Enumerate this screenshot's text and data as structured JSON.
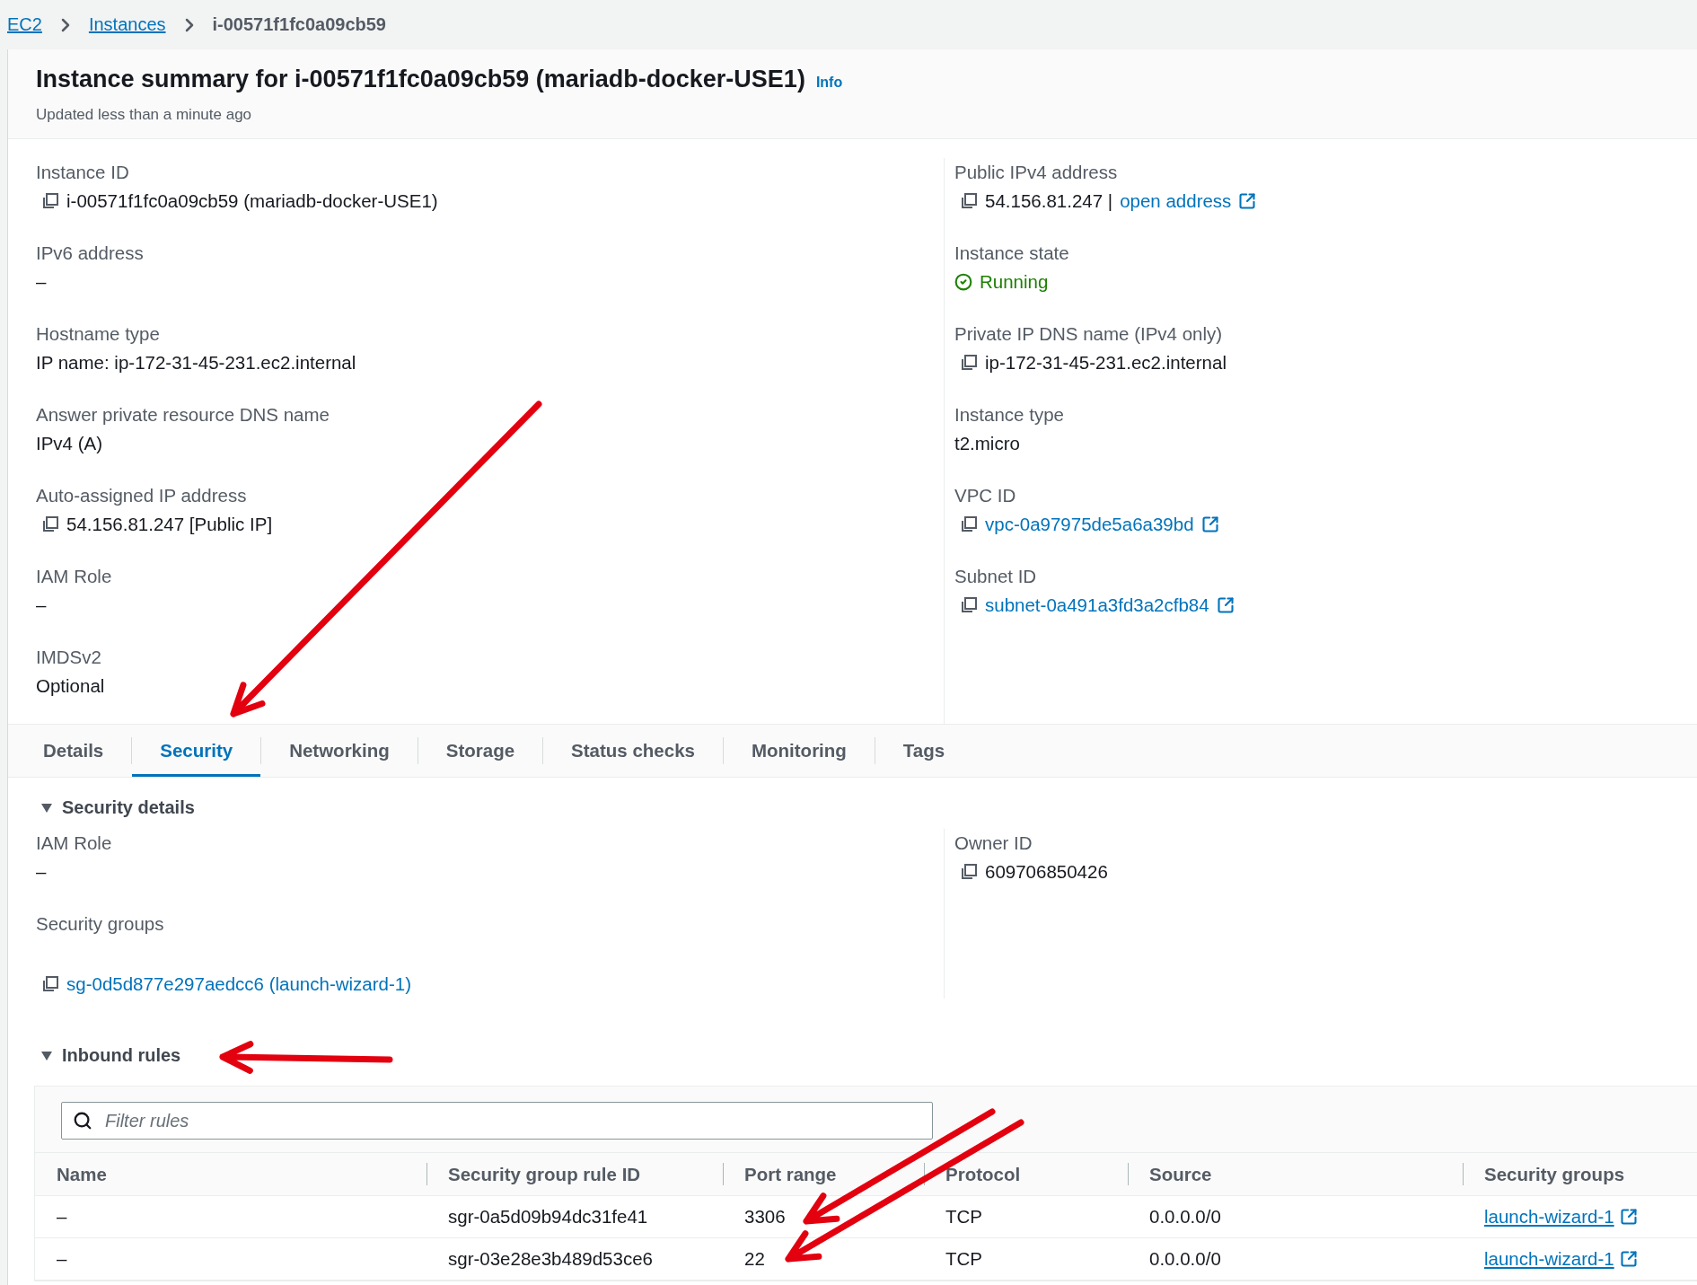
{
  "breadcrumb": [
    {
      "label": "EC2",
      "kind": "link"
    },
    {
      "label": "Instances",
      "kind": "link"
    },
    {
      "label": "i-00571f1fc0a09cb59",
      "kind": "current"
    }
  ],
  "summary": {
    "title": "Instance summary for i-00571f1fc0a09cb59 (mariadb-docker-USE1)",
    "info": "Info",
    "updated": "Updated less than a minute ago"
  },
  "fields_left": [
    {
      "label": "Instance ID",
      "value": "i-00571f1fc0a09cb59 (mariadb-docker-USE1)",
      "kind": "copy"
    },
    {
      "label": "IPv6 address",
      "value": "–",
      "kind": "text"
    },
    {
      "label": "Hostname type",
      "value": "IP name: ip-172-31-45-231.ec2.internal",
      "kind": "text"
    },
    {
      "label": "Answer private resource DNS name",
      "value": "IPv4 (A)",
      "kind": "text"
    },
    {
      "label": "Auto-assigned IP address",
      "value": "54.156.81.247 [Public IP]",
      "kind": "copy"
    },
    {
      "label": "IAM Role",
      "value": "–",
      "kind": "text"
    },
    {
      "label": "IMDSv2",
      "value": "Optional",
      "kind": "text"
    }
  ],
  "fields_right": [
    {
      "label": "Public IPv4 address",
      "value": "54.156.81.247 |",
      "link": "open address",
      "external": true,
      "kind": "copy"
    },
    {
      "label": "Instance state",
      "value": "Running",
      "kind": "status"
    },
    {
      "label": "Private IP DNS name (IPv4 only)",
      "value": "ip-172-31-45-231.ec2.internal",
      "kind": "copy"
    },
    {
      "label": "Instance type",
      "value": "t2.micro",
      "kind": "text"
    },
    {
      "label": "VPC ID",
      "link": "vpc-0a97975de5a6a39bd",
      "external": true,
      "kind": "copy"
    },
    {
      "label": "Subnet ID",
      "link": "subnet-0a491a3fd3a2cfb84",
      "external": true,
      "kind": "copy"
    }
  ],
  "tabs": [
    {
      "label": "Details",
      "selected": false
    },
    {
      "label": "Security",
      "selected": true
    },
    {
      "label": "Networking",
      "selected": false
    },
    {
      "label": "Storage",
      "selected": false
    },
    {
      "label": "Status checks",
      "selected": false
    },
    {
      "label": "Monitoring",
      "selected": false
    },
    {
      "label": "Tags",
      "selected": false
    }
  ],
  "security_details": {
    "title": "Security details",
    "expanded": true,
    "fields_left": [
      {
        "label": "IAM Role",
        "value": "–",
        "kind": "text"
      },
      {
        "label": "Security groups",
        "link": "sg-0d5d877e297aedcc6 (launch-wizard-1)",
        "external": false,
        "kind": "copy"
      }
    ],
    "fields_right": [
      {
        "label": "Owner ID",
        "value": "609706850426",
        "kind": "copy"
      }
    ]
  },
  "inbound_rules": {
    "title": "Inbound rules",
    "expanded": true,
    "filter": {
      "placeholder": "Filter rules"
    },
    "columns": [
      "Name",
      "Security group rule ID",
      "Port range",
      "Protocol",
      "Source",
      "Security groups"
    ],
    "rows": [
      {
        "cells": [
          "–",
          "sgr-0a5d09b94dc31fe41",
          "3306",
          "TCP",
          "0.0.0.0/0",
          "launch-wizard-1"
        ]
      },
      {
        "cells": [
          "–",
          "sgr-03e28e3b489d53ce6",
          "22",
          "TCP",
          "0.0.0.0/0",
          "launch-wizard-1"
        ]
      }
    ]
  }
}
